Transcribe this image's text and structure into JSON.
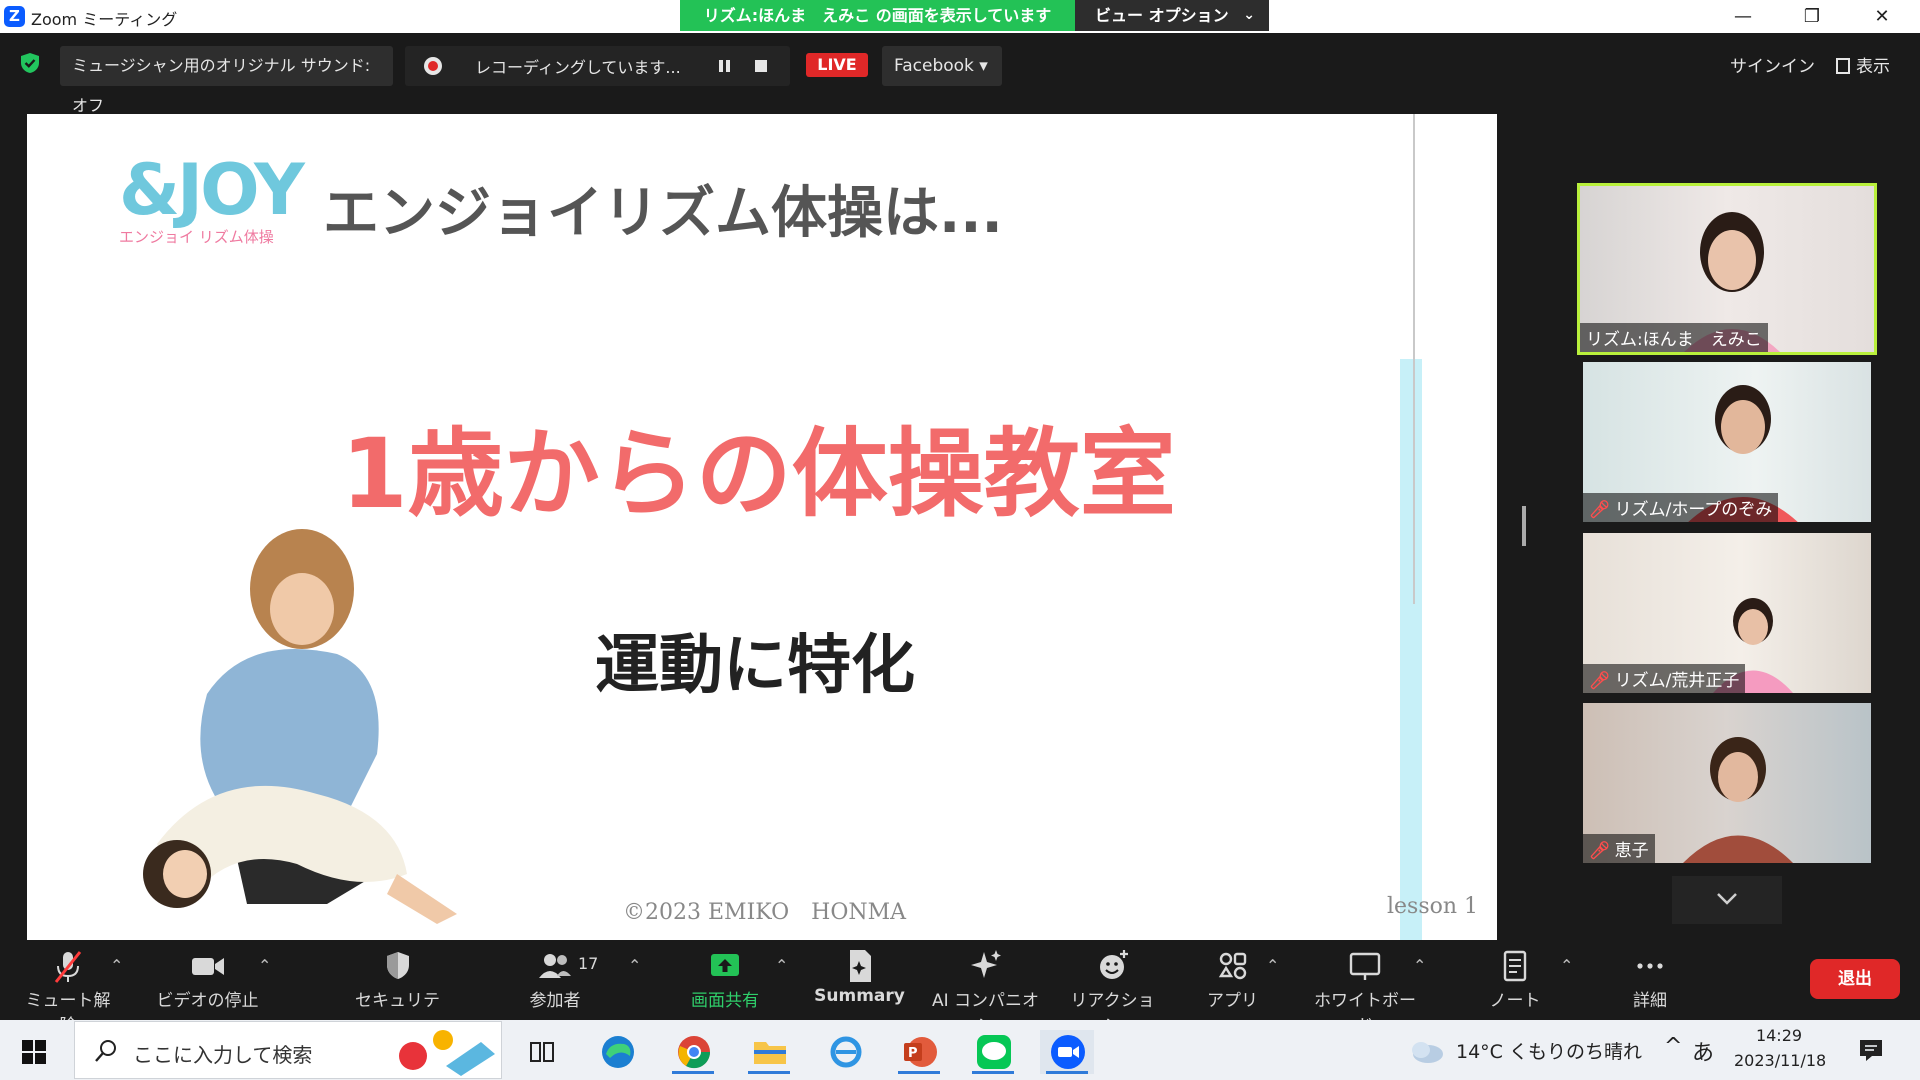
{
  "window": {
    "title": "Zoom ミーティング",
    "share_banner": "リズム:ほんま　えみこ の画面を表示しています",
    "view_options": "ビュー オプション",
    "chev": "⌄",
    "minimize": "—",
    "maximize": "❐",
    "close": "✕"
  },
  "topbar": {
    "audio_status": "ミュージシャン用のオリジナル サウンド: オフ",
    "recording": "レコーディングしています...",
    "live": "LIVE",
    "stream_target": "Facebook ▾",
    "signin": "サインイン",
    "view": "表示"
  },
  "slide": {
    "logo": "&JOY",
    "logo_sub": "エンジョイ リズム体操",
    "title": "エンジョイリズム体操は...",
    "heading": "1歳からの体操教室",
    "subheading": "運動に特化",
    "copyright": "©2023 EMIKO　HONMA",
    "lesson": "lesson 1"
  },
  "participants": [
    {
      "name": "リズム:ほんま　えみこ",
      "muted": false
    },
    {
      "name": "リズム/ホープのぞみ",
      "muted": true
    },
    {
      "name": "リズム/荒井正子",
      "muted": true
    },
    {
      "name": "恵子",
      "muted": true
    }
  ],
  "participant_mic_off_glyph": "🎤︎",
  "toolbar": {
    "unmute": "ミュート解除",
    "stop_video": "ビデオの停止",
    "security": "セキュリティ",
    "participants": "参加者",
    "participant_count": "17",
    "share_screen": "画面共有",
    "summary": "Summary",
    "ai_companion": "AI コンパニオン",
    "reactions": "リアクション",
    "apps": "アプリ",
    "whiteboard": "ホワイトボード",
    "notes": "ノート",
    "more": "詳細",
    "leave": "退出",
    "caret": "⌃"
  },
  "taskbar": {
    "search_placeholder": "ここに入力して検索",
    "weather": "14°C くもりのち晴れ",
    "tray_up": "^",
    "ime": "あ",
    "time": "14:29",
    "date": "2023/11/18"
  },
  "colors": {
    "share_green": "#23c256",
    "live_red": "#e02828",
    "heading_pink": "#f26b6b",
    "active_speaker": "#b9f03c"
  }
}
